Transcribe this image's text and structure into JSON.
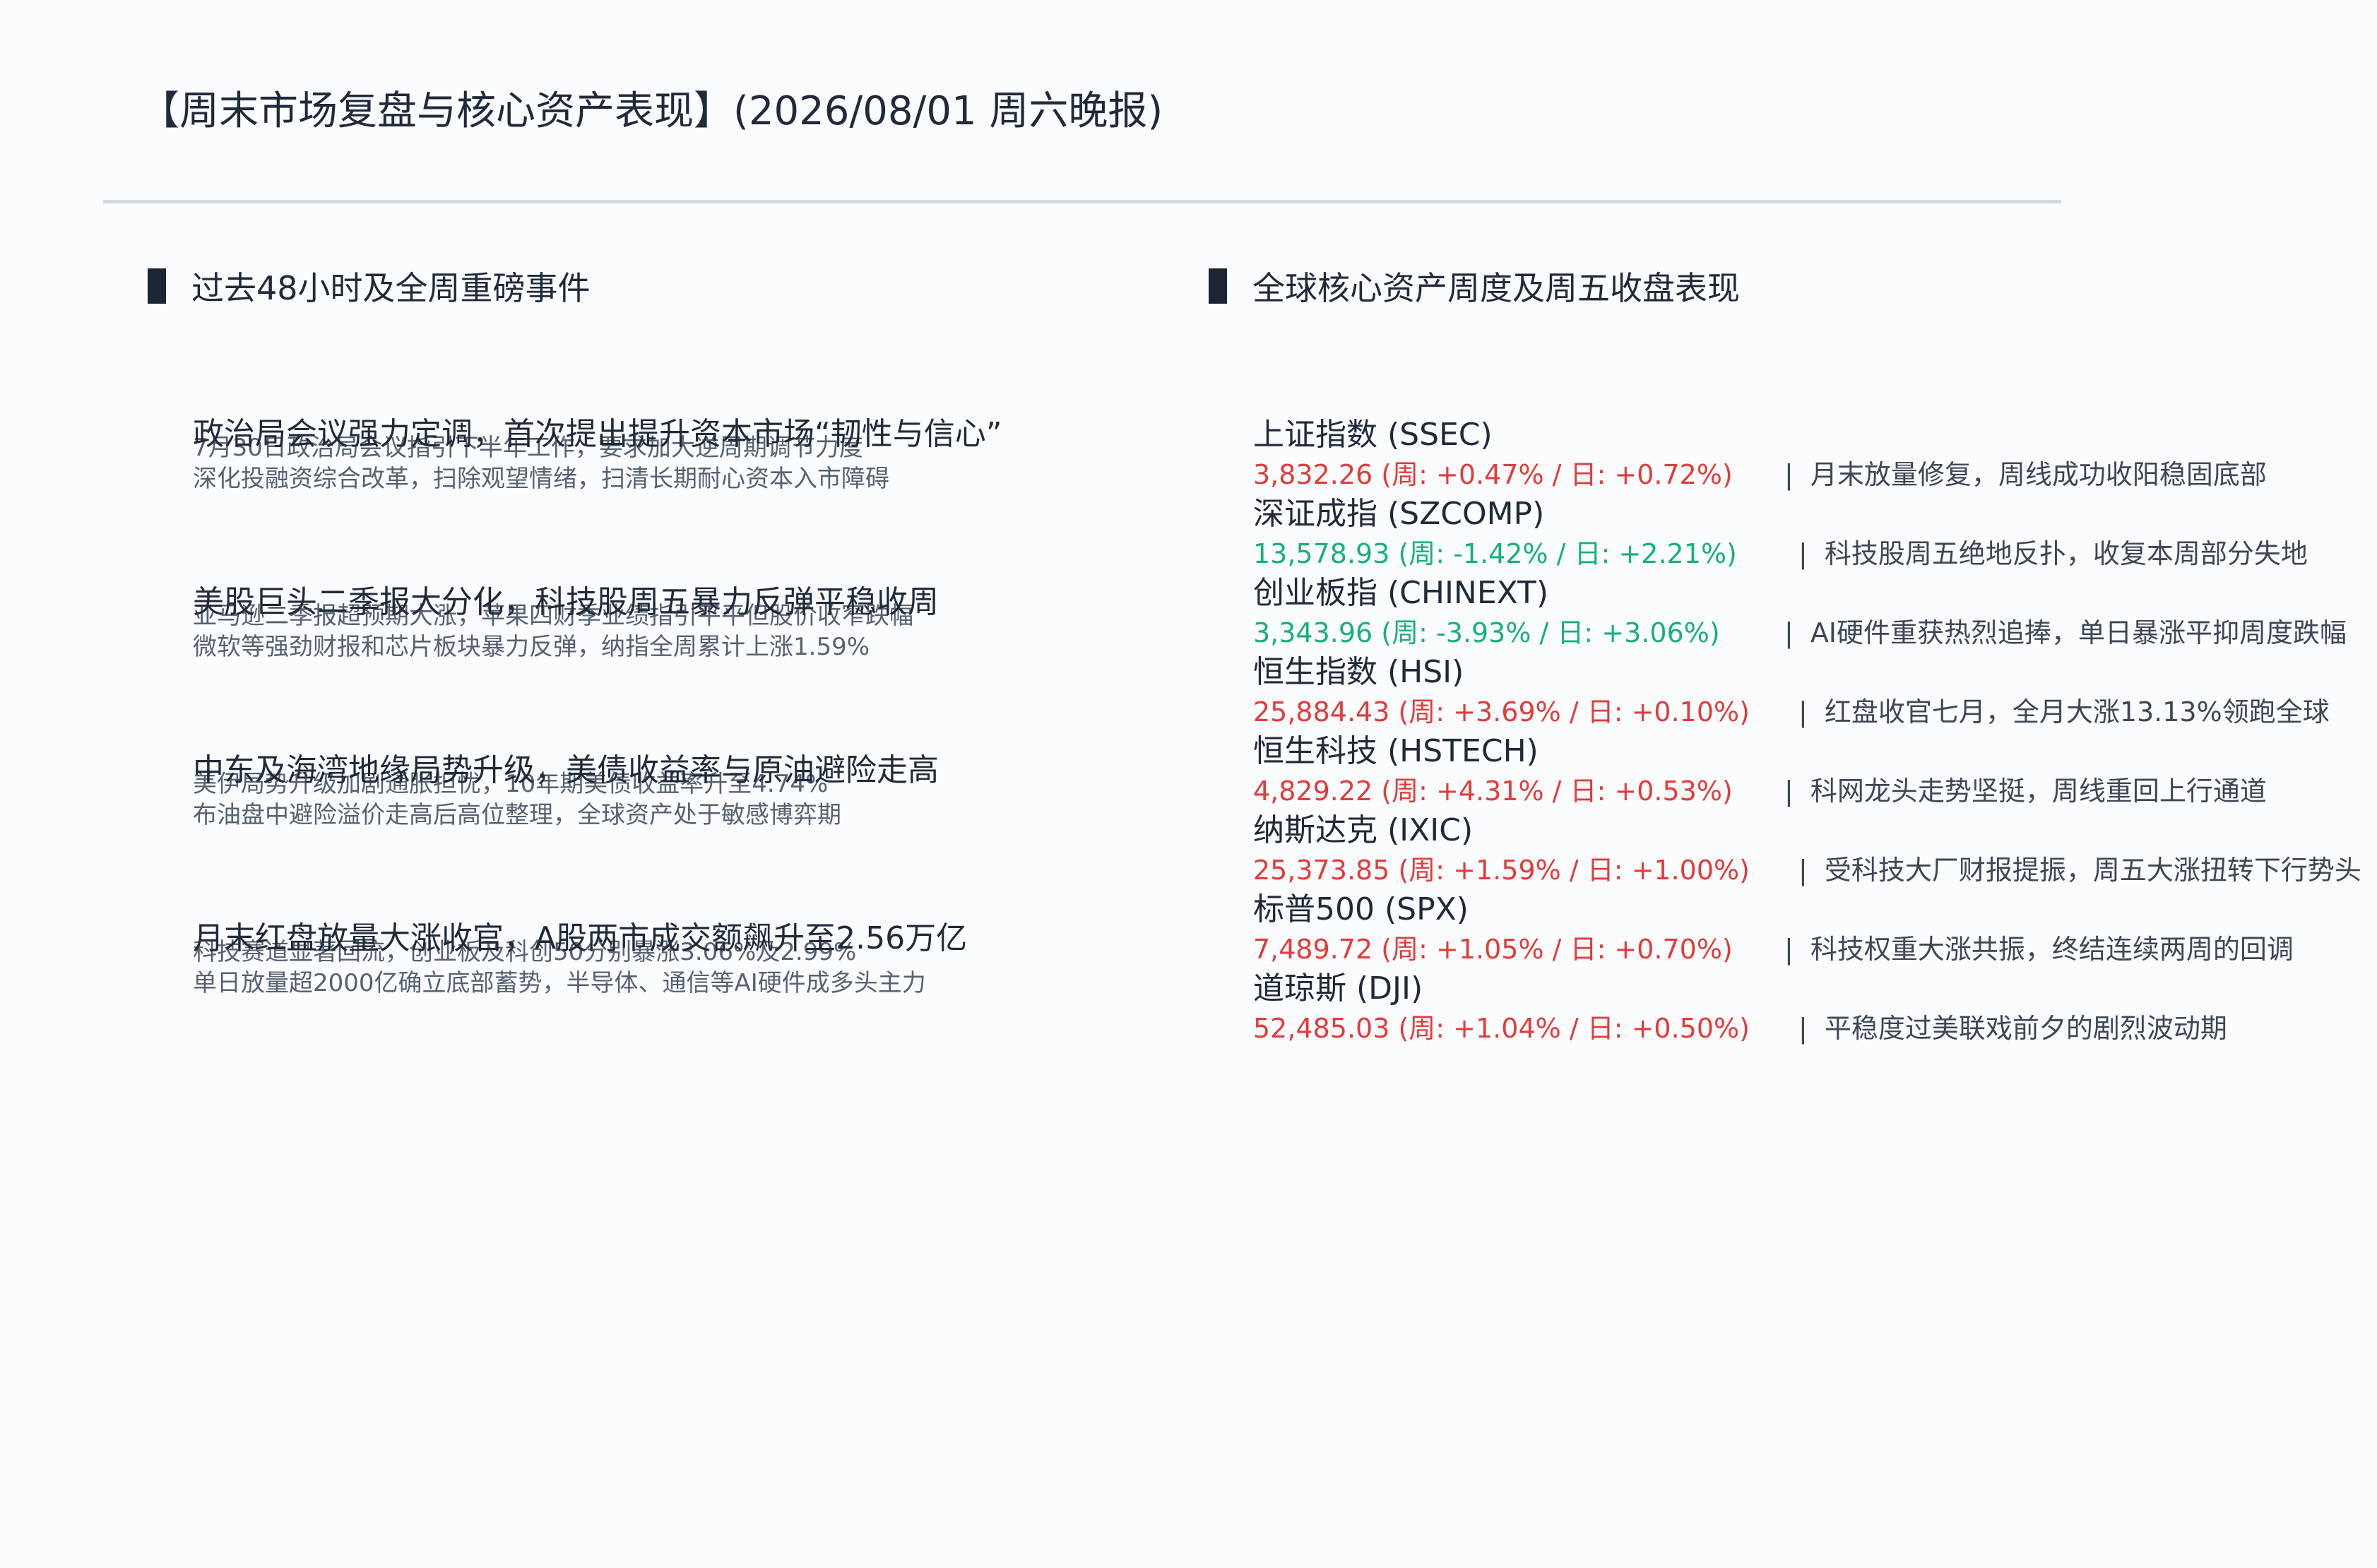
{
  "title": "【周末市场复盘与核心资产表现】(2026/08/01 周六晚报)",
  "sections": {
    "events_title": "过去48小时及全周重磅事件",
    "assets_title": "全球核心资产周度及周五收盘表现"
  },
  "colors": {
    "up": "#e23b3b",
    "down": "#17b07d",
    "rule": "#cfdbe6"
  },
  "events": [
    {
      "headline": "政治局会议强力定调，首次提出提升资本市场“韧性与信心”",
      "detail_1": "7月30日政治局会议指引下半年工作，要求加大逆周期调节力度",
      "detail_2": "深化投融资综合改革，扫除观望情绪，扫清长期耐心资本入市障碍"
    },
    {
      "headline": "美股巨头二季报大分化，科技股周五暴力反弹平稳收周",
      "detail_1": "亚马逊二季报超预期大涨，苹果四财季业绩指引平平但股价收窄跌幅",
      "detail_2": "微软等强劲财报和芯片板块暴力反弹，纳指全周累计上涨1.59%"
    },
    {
      "headline": "中东及海湾地缘局势升级，美债收益率与原油避险走高",
      "detail_1": "美伊局势升级加剧通胀担忧，10年期美债收益率升至4.74%",
      "detail_2": "布油盘中避险溢价走高后高位整理，全球资产处于敏感博弈期"
    },
    {
      "headline": "月末红盘放量大涨收官，A股两市成交额飙升至2.56万亿",
      "detail_1": "科技赛道显著回流，创业板及科创50分别暴涨3.06%及2.99%",
      "detail_2": "单日放量超2000亿确立底部蓄势，半导体、通信等AI硬件成多头主力"
    }
  ],
  "assets": [
    {
      "name": "上证指数 (SSEC)",
      "quote": "3,832.26 (周: +0.47% / 日: +0.72%)",
      "trend": "up",
      "note_sep": "|",
      "note": "月末放量修复，周线成功收阳稳固底部"
    },
    {
      "name": "深证成指 (SZCOMP)",
      "quote": "13,578.93 (周: -1.42% / 日: +2.21%)",
      "trend": "down",
      "note_sep": "|",
      "note": "科技股周五绝地反扑，收复本周部分失地"
    },
    {
      "name": "创业板指 (CHINEXT)",
      "quote": "3,343.96 (周: -3.93% / 日: +3.06%)",
      "trend": "down",
      "note_sep": "|",
      "note": "AI硬件重获热烈追捧，单日暴涨平抑周度跌幅"
    },
    {
      "name": "恒生指数 (HSI)",
      "quote": "25,884.43 (周: +3.69% / 日: +0.10%)",
      "trend": "up",
      "note_sep": "|",
      "note": "红盘收官七月，全月大涨13.13%领跑全球"
    },
    {
      "name": "恒生科技 (HSTECH)",
      "quote": "4,829.22 (周: +4.31% / 日: +0.53%)",
      "trend": "up",
      "note_sep": "|",
      "note": "科网龙头走势坚挺，周线重回上行通道"
    },
    {
      "name": "纳斯达克 (IXIC)",
      "quote": "25,373.85 (周: +1.59% / 日: +1.00%)",
      "trend": "up",
      "note_sep": "|",
      "note": "受科技大厂财报提振，周五大涨扭转下行势头"
    },
    {
      "name": "标普500 (SPX)",
      "quote": "7,489.72 (周: +1.05% / 日: +0.70%)",
      "trend": "up",
      "note_sep": "|",
      "note": "科技权重大涨共振，终结连续两周的回调"
    },
    {
      "name": "道琼斯 (DJI)",
      "quote": "52,485.03 (周: +1.04% / 日: +0.50%)",
      "trend": "up",
      "note_sep": "|",
      "note": "平稳度过美联戏前夕的剧烈波动期"
    }
  ]
}
